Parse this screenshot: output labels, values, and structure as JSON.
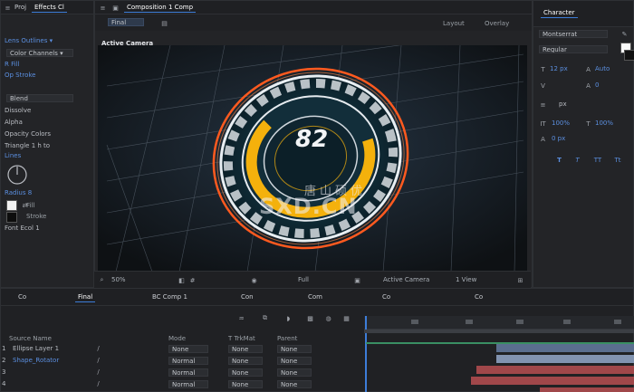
{
  "project_panel": {
    "tabs": [
      "Proj",
      "Effects Cl"
    ],
    "rows": [
      "Lens  Outlines  ▾",
      "Color Channels ▾",
      "R  Fill",
      "Op Stroke",
      "Blend",
      "Dissolve",
      "Alpha",
      "Opacity Colors",
      "Triangle 1 h to",
      "Lines",
      "Radius 8",
      "Fill",
      "Font  Ecol  1"
    ],
    "color_swatch_labels": [
      "Fill",
      "Stroke"
    ]
  },
  "composition_panel": {
    "tab_label": "Composition 1 Comp",
    "view_tab_label": "Final",
    "view_selector": "Final",
    "right_controls": [
      "Layout",
      "Overlay"
    ],
    "camera_label": "Active Camera",
    "gauge_value": "82",
    "watermark_cn": "唐山硕优",
    "watermark_url": "SXD.CN",
    "footer_items": [
      "50%",
      "Full",
      "Active Camera",
      "1 View"
    ]
  },
  "character_panel": {
    "title": "Character",
    "font_family": "Montserrat",
    "font_style": "Regular",
    "size_label": "12 px",
    "leading_label": "Auto",
    "tracking_label": "0",
    "scale_v_label": "100%",
    "scale_h_label": "100%",
    "baseline_label": "0 px",
    "unit_label": "px",
    "format_buttons": [
      "T",
      "T",
      "TT",
      "Tt"
    ]
  },
  "timeline_panel": {
    "tabs": [
      "Co",
      "Final",
      "BC Comp 1",
      "Con",
      "Com",
      "Co",
      "Co"
    ],
    "columns": [
      "Source Name",
      "Mode",
      "T TrkMat",
      "Parent"
    ],
    "layers": [
      {
        "num": "1",
        "name": "Ellipse Layer 1",
        "mode": "None",
        "trk": "None",
        "parent": "None"
      },
      {
        "num": "2",
        "name": "Shape_Rotator",
        "mode": "Normal",
        "trk": "None",
        "parent": "None"
      },
      {
        "num": "3",
        "name": "",
        "mode": "Normal",
        "trk": "None",
        "parent": "None"
      },
      {
        "num": "4",
        "name": "",
        "mode": "Normal",
        "trk": "None",
        "parent": "None"
      }
    ],
    "playhead_fraction": 0.005
  },
  "colors": {
    "accent_blue": "#3d7dd8",
    "gauge_yellow": "#f4b10c",
    "ring_orange": "#ff5a1f",
    "bar_blue": "#5a6e8f",
    "bar_red": "#a0474a",
    "bar_green": "#3a8f63"
  }
}
